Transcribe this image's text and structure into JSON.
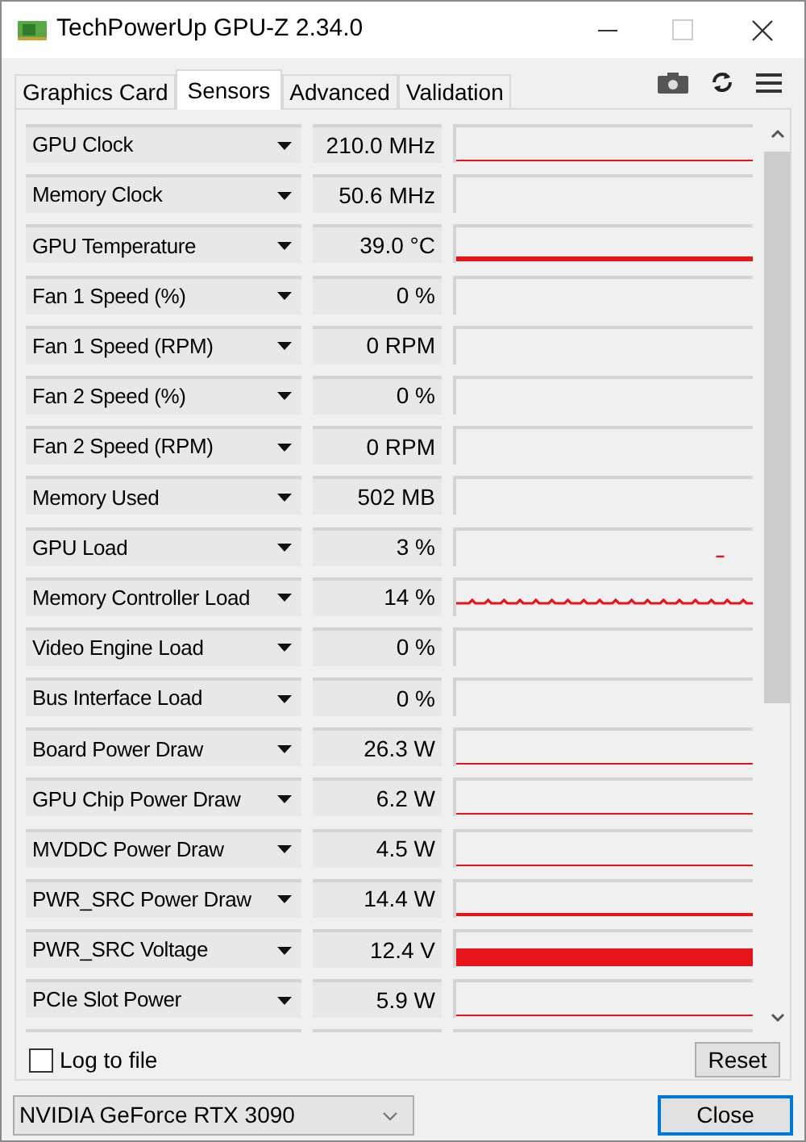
{
  "window": {
    "title": "TechPowerUp GPU-Z 2.34.0"
  },
  "tabs": [
    {
      "label": "Graphics Card",
      "selected": false
    },
    {
      "label": "Sensors",
      "selected": true
    },
    {
      "label": "Advanced",
      "selected": false
    },
    {
      "label": "Validation",
      "selected": false
    }
  ],
  "sensors": [
    {
      "name": "GPU Clock",
      "value": "210.0 MHz",
      "kind": "thin"
    },
    {
      "name": "Memory Clock",
      "value": "50.6 MHz",
      "kind": "empty"
    },
    {
      "name": "GPU Temperature",
      "value": "39.0 °C",
      "kind": "thick"
    },
    {
      "name": "Fan 1 Speed (%)",
      "value": "0 %",
      "kind": "empty"
    },
    {
      "name": "Fan 1 Speed (RPM)",
      "value": "0 RPM",
      "kind": "empty"
    },
    {
      "name": "Fan 2 Speed (%)",
      "value": "0 %",
      "kind": "empty"
    },
    {
      "name": "Fan 2 Speed (RPM)",
      "value": "0 RPM",
      "kind": "empty"
    },
    {
      "name": "Memory Used",
      "value": "502 MB",
      "kind": "empty"
    },
    {
      "name": "GPU Load",
      "value": "3 %",
      "kind": "blip"
    },
    {
      "name": "Memory Controller Load",
      "value": "14 %",
      "kind": "noise"
    },
    {
      "name": "Video Engine Load",
      "value": "0 %",
      "kind": "empty"
    },
    {
      "name": "Bus Interface Load",
      "value": "0 %",
      "kind": "empty"
    },
    {
      "name": "Board Power Draw",
      "value": "26.3 W",
      "kind": "thin"
    },
    {
      "name": "GPU Chip Power Draw",
      "value": "6.2 W",
      "kind": "thin"
    },
    {
      "name": "MVDDC Power Draw",
      "value": "4.5 W",
      "kind": "thin"
    },
    {
      "name": "PWR_SRC Power Draw",
      "value": "14.4 W",
      "kind": "medium"
    },
    {
      "name": "PWR_SRC Voltage",
      "value": "12.4 V",
      "kind": "bar"
    },
    {
      "name": "PCIe Slot Power",
      "value": "5.9 W",
      "kind": "thin"
    }
  ],
  "log_to_file": {
    "label": "Log to file",
    "checked": false
  },
  "reset_button": "Reset",
  "device_select": {
    "value": "NVIDIA GeForce RTX 3090"
  },
  "close_button": "Close"
}
